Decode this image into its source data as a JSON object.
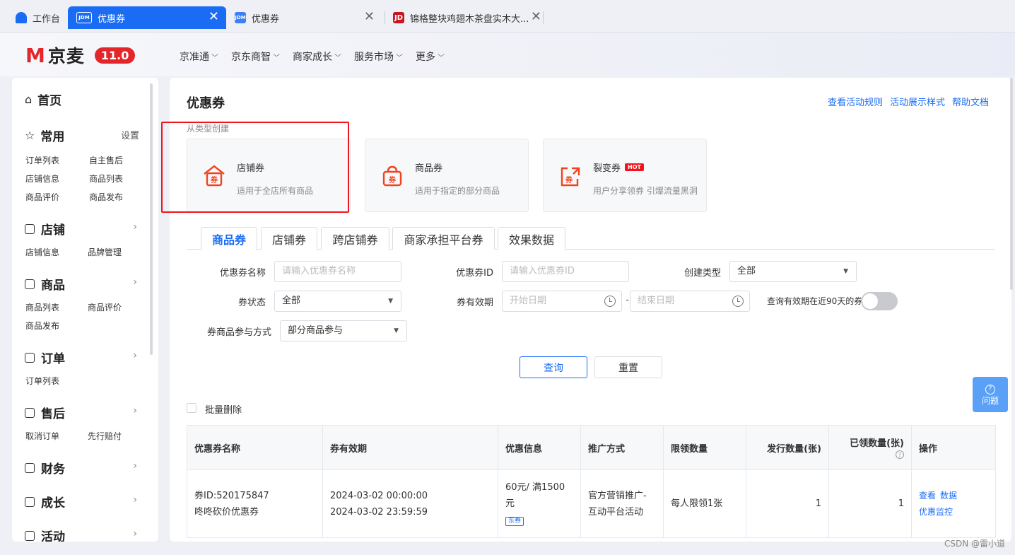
{
  "browser_tabs": [
    {
      "label": "工作台",
      "icon": "home-icon"
    },
    {
      "label": "优惠券",
      "icon": "jdm-icon",
      "active": true
    },
    {
      "label": "优惠券",
      "icon": "jdm-icon"
    },
    {
      "label": "锦格整块鸡翅木茶盘实木大...",
      "icon": "jd-icon"
    }
  ],
  "header": {
    "logo_m": "M",
    "logo_name": "京麦",
    "version": "11.0",
    "nav": [
      "京准通",
      "京东商智",
      "商家成长",
      "服务市场",
      "更多"
    ]
  },
  "sidebar": {
    "home": "首页",
    "common": "常用",
    "settings": "设置",
    "common_links": [
      "订单列表",
      "自主售后",
      "店铺信息",
      "商品列表",
      "商品评价",
      "商品发布"
    ],
    "shop": "店铺",
    "shop_links": [
      "店铺信息",
      "品牌管理"
    ],
    "goods": "商品",
    "goods_links": [
      "商品列表",
      "商品评价",
      "商品发布"
    ],
    "order": "订单",
    "order_links": [
      "订单列表"
    ],
    "aftersale": "售后",
    "aftersale_links": [
      "取消订单",
      "先行赔付"
    ],
    "finance": "财务",
    "growth": "成长",
    "activity": "活动"
  },
  "main": {
    "title": "优惠券",
    "right_links": [
      "查看活动规则",
      "活动展示样式",
      "帮助文档"
    ],
    "from_type": "从类型创建",
    "cards": [
      {
        "title": "店铺券",
        "desc": "适用于全店所有商品"
      },
      {
        "title": "商品券",
        "desc": "适用于指定的部分商品"
      },
      {
        "title": "裂变券",
        "desc": "用户分享领券 引爆流量黑洞",
        "badge": "HOT"
      }
    ],
    "tabs": [
      "商品券",
      "店铺券",
      "跨店铺券",
      "商家承担平台券",
      "效果数据"
    ]
  },
  "filters": {
    "name_label": "优惠券名称",
    "name_placeholder": "请输入优惠券名称",
    "id_label": "优惠券ID",
    "id_placeholder": "请输入优惠券ID",
    "create_type_label": "创建类型",
    "create_type_value": "全部",
    "status_label": "券状态",
    "status_value": "全部",
    "validity_label": "券有效期",
    "start_placeholder": "开始日期",
    "end_placeholder": "结束日期",
    "date_sep": "-",
    "recent_label": "查询有效期在近90天的券",
    "recent_on": false,
    "participation_label": "券商品参与方式",
    "participation_value": "部分商品参与",
    "query": "查询",
    "reset": "重置"
  },
  "batch_delete": "批量删除",
  "table": {
    "headers": [
      "优惠券名称",
      "券有效期",
      "优惠信息",
      "推广方式",
      "限领数量",
      "发行数量(张)",
      "已领数量(张)",
      "操作"
    ],
    "rows": [
      {
        "id_line": "券ID:520175847",
        "name": "咚咚砍价优惠券",
        "valid_from": "2024-03-02 00:00:00",
        "valid_to": "2024-03-02 23:59:59",
        "discount_1": "60元/ 满1500",
        "discount_2": "元",
        "tag": "东券",
        "promo_1": "官方营销推广-",
        "promo_2": "互动平台活动",
        "limit": "每人限领1张",
        "issued": "1",
        "received": "1",
        "actions": [
          "查看",
          "数据",
          "优惠监控"
        ]
      }
    ]
  },
  "help_button": "问题",
  "watermark": "CSDN @雷小道",
  "colors": {
    "primary": "#1a6cf5",
    "brand_red": "#e4262a",
    "highlight_box": "#f0141e"
  }
}
